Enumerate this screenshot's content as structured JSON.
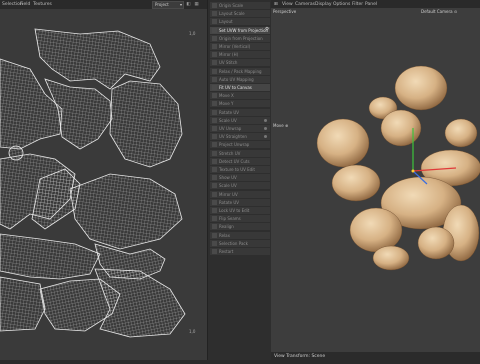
{
  "uv_editor": {
    "menu": [
      "Selection",
      "Field",
      "Textures"
    ],
    "mode_select": "Project",
    "corner_top_right": "1,0",
    "corner_bottom_right": "1,0"
  },
  "tools_panel": {
    "items": [
      {
        "label": "Origin Scale",
        "state": "disabled"
      },
      {
        "label": "Layout Scale",
        "state": "disabled"
      },
      {
        "label": "Layout",
        "state": "disabled"
      },
      {
        "label": "Set UVW from Projection",
        "state": "active",
        "icon": "gear-icon"
      },
      {
        "label": "Origin from Projection",
        "state": "disabled"
      },
      {
        "label": "Mirror (Vertical)",
        "state": "disabled"
      },
      {
        "label": "Mirror (H)",
        "state": "disabled"
      },
      {
        "label": "UV Stitch",
        "state": "disabled"
      },
      {
        "label": "Relax / Pack Mapping",
        "state": "disabled"
      },
      {
        "label": "Auto UV Mapping",
        "state": "disabled"
      },
      {
        "label": "Fit UV to Canvas",
        "state": "active"
      },
      {
        "label": "Move X",
        "state": "disabled"
      },
      {
        "label": "Move Y",
        "state": "disabled"
      },
      {
        "label": "Rotate UV",
        "state": "disabled"
      },
      {
        "label": "Scale UV",
        "state": "disabled",
        "dot": true
      },
      {
        "label": "UV Unwrap",
        "state": "disabled",
        "dot": true
      },
      {
        "label": "UV Straighten",
        "state": "disabled",
        "dot": true
      },
      {
        "label": "Project Unwrap",
        "state": "disabled"
      },
      {
        "label": "Stretch UV",
        "state": "disabled"
      },
      {
        "label": "Detect UV Cuts",
        "state": "disabled"
      },
      {
        "label": "Texture to UV Edit",
        "state": "disabled"
      },
      {
        "label": "Show UV",
        "state": "disabled"
      },
      {
        "label": "Scale UV",
        "state": "disabled"
      },
      {
        "label": "Mirror UV",
        "state": "disabled"
      },
      {
        "label": "Rotate UV",
        "state": "disabled"
      },
      {
        "label": "Lock UV to Edit",
        "state": "disabled"
      },
      {
        "label": "Flip Seams",
        "state": "disabled"
      },
      {
        "label": "Realign",
        "state": "disabled"
      },
      {
        "label": "Relax",
        "state": "disabled"
      },
      {
        "label": "Selection Pack",
        "state": "disabled"
      },
      {
        "label": "Restart",
        "state": "disabled"
      }
    ]
  },
  "viewport": {
    "menu": [
      "View",
      "Cameras",
      "Display",
      "Options",
      "Filter",
      "Panel"
    ],
    "view_name": "Perspective",
    "camera_name": "Default Camera ⊙",
    "tool_label": "Move ⊕",
    "status": "View Transform: Scene",
    "axis_colors": {
      "x": "#e03a3a",
      "y": "#3cc43c",
      "z": "#3a6ee0"
    }
  },
  "colors": {
    "uv_wire": "#dcdcdc",
    "mesh_base": "#d9b98e",
    "mesh_shadow": "#8a6a48"
  }
}
